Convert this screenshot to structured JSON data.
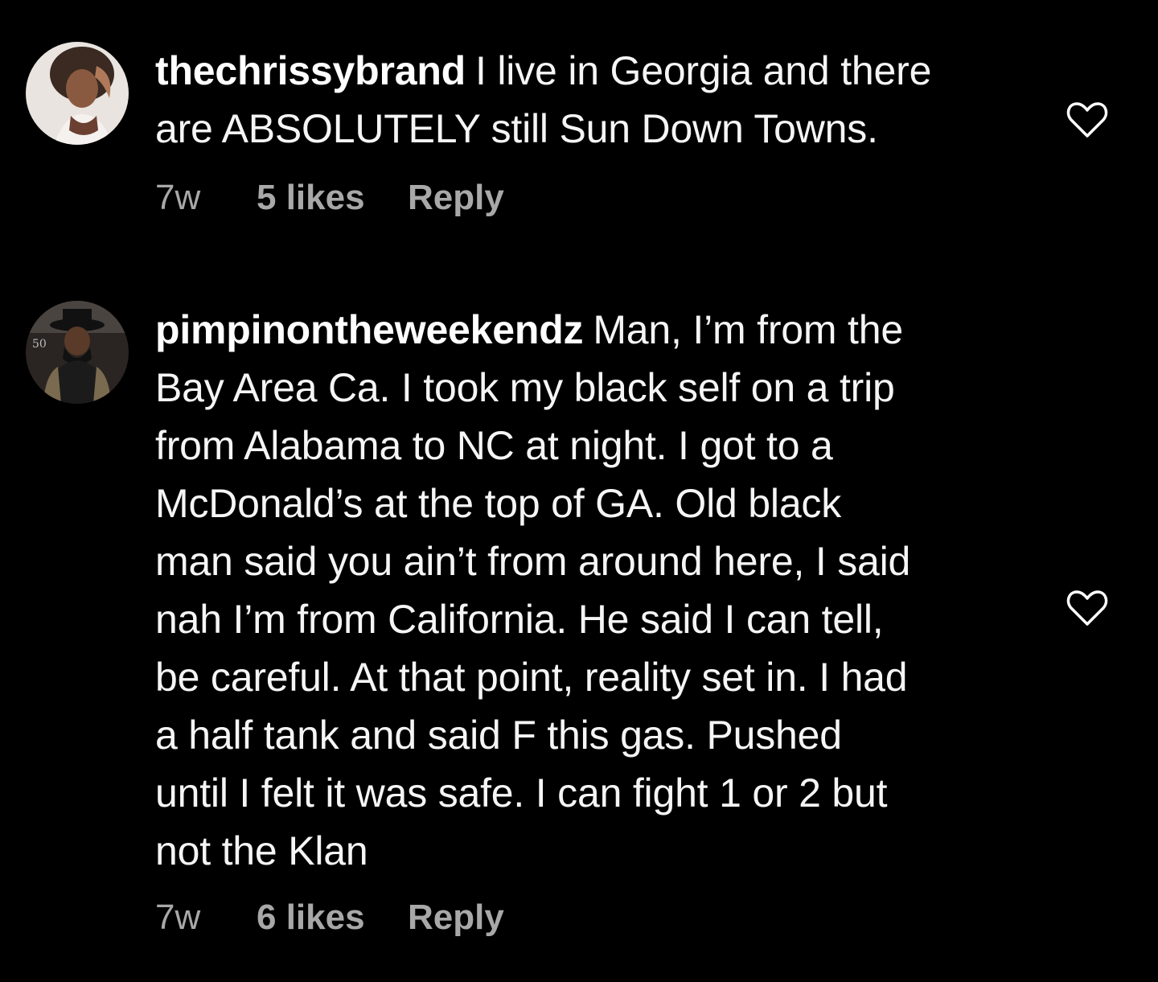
{
  "comments": [
    {
      "username": "thechrissybrand",
      "lines": [
        "I live in Georgia and there",
        "are ABSOLUTELY still Sun Down Towns."
      ],
      "time": "7w",
      "likes": "5 likes",
      "reply": "Reply"
    },
    {
      "username": "pimpinontheweekendz",
      "lines": [
        "Man, I’m from the",
        "Bay Area Ca. I took my black self on a trip",
        "from Alabama to NC at night. I got to a",
        "McDonald’s at the top of GA. Old black",
        "man said you ain’t from around here, I said",
        "nah I’m from California. He said I can tell,",
        "be careful. At that point, reality set in. I had",
        "a half tank and said F this gas. Pushed",
        "until I felt it was safe. I can fight 1 or 2 but",
        "not the Klan"
      ],
      "time": "7w",
      "likes": "6 likes",
      "reply": "Reply"
    }
  ],
  "icons": {
    "like": "heart-outline-icon"
  },
  "colors": {
    "background": "#000000",
    "text": "#ffffff",
    "meta": "#a8a8a8"
  }
}
